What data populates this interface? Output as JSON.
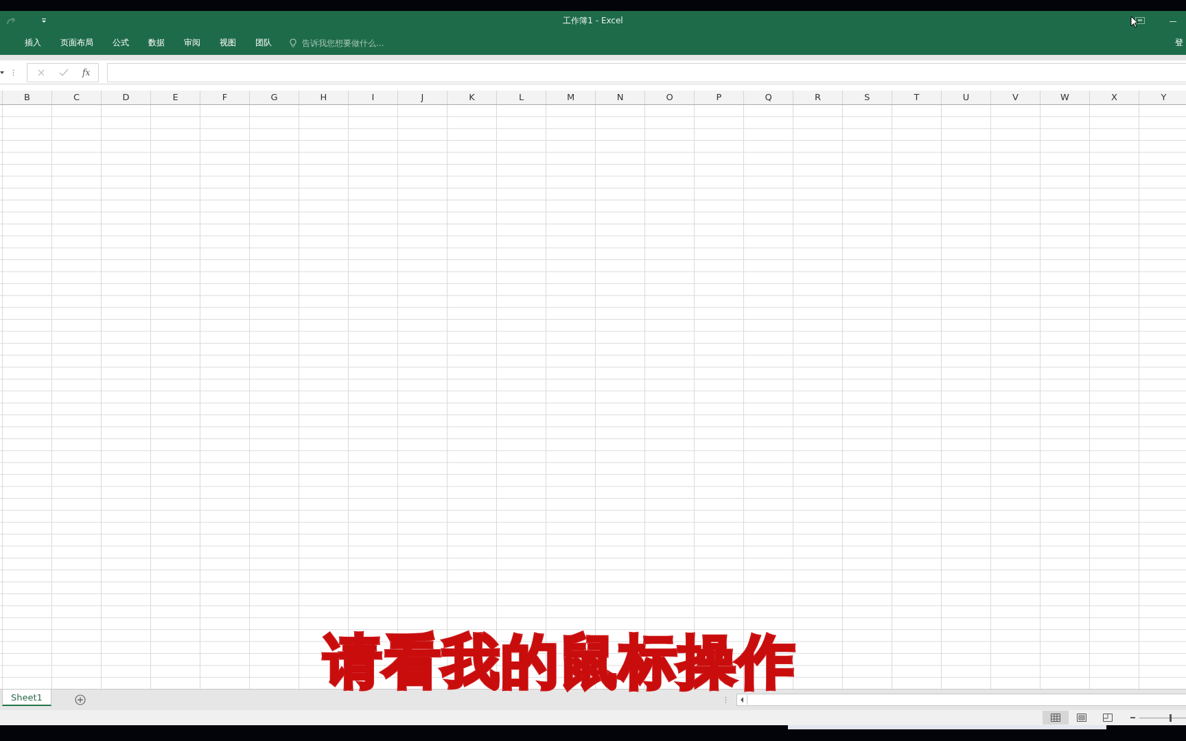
{
  "window": {
    "title": "工作簿1 - Excel"
  },
  "ribbon_tabs": [
    {
      "label": "插入"
    },
    {
      "label": "页面布局"
    },
    {
      "label": "公式"
    },
    {
      "label": "数据"
    },
    {
      "label": "审阅"
    },
    {
      "label": "视图"
    },
    {
      "label": "团队"
    }
  ],
  "tell_me": {
    "placeholder": "告诉我您想要做什么..."
  },
  "account": "登",
  "formula_bar": {
    "function_label": "fx"
  },
  "columns": [
    "B",
    "C",
    "D",
    "E",
    "F",
    "G",
    "H",
    "I",
    "J",
    "K",
    "L",
    "M",
    "N",
    "O",
    "P",
    "Q",
    "R",
    "S",
    "T",
    "U",
    "V",
    "W",
    "X",
    "Y"
  ],
  "sheet_tabs": [
    {
      "label": "Sheet1",
      "selected": true
    }
  ],
  "views": [
    {
      "kind": "normal",
      "selected": true
    },
    {
      "kind": "page-layout",
      "selected": false
    },
    {
      "kind": "page-break",
      "selected": false
    }
  ],
  "zoom": {
    "level": 0.65
  },
  "caption": "请看我的鼠标操作"
}
